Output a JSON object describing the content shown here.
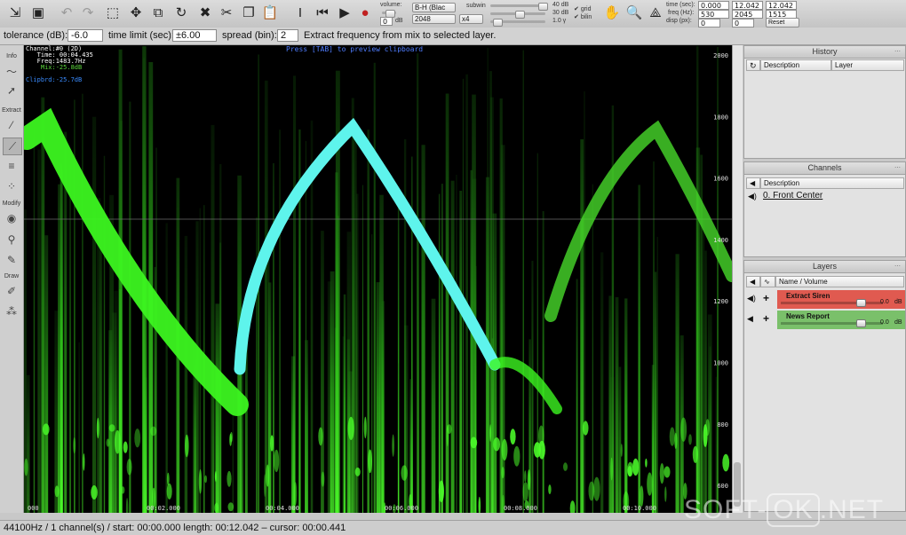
{
  "toolbar": {
    "volume_label": "volume:",
    "volume_value": "0",
    "volume_unit": "dB",
    "colormap": "B-H (Blac",
    "fft_size": "2048",
    "subwin_label": "subwin",
    "multiplier": "x4",
    "db_top": "40 dB",
    "db_mid": "30 dB",
    "db_gamma": "1.0 γ",
    "grid_label": "grid",
    "bilin_label": "bilin",
    "time_label": "time (sec):",
    "time_start": "0.000",
    "time_mid": "12.042",
    "time_end": "12.042",
    "freq_label": "freq (Hz):",
    "freq_start": "530",
    "freq_mid": "2045",
    "freq_end": "1515",
    "disp_label": "disp (px):",
    "disp_start": "0",
    "disp_end": "0",
    "reset_view": "Reset View"
  },
  "options": {
    "tolerance_label": "tolerance (dB):",
    "tolerance_value": "-6.0",
    "time_limit_label": "time limit (sec):",
    "time_limit_value": "±6.00",
    "spread_label": "spread (bin):",
    "spread_value": "2",
    "hint": "Extract frequency from mix to selected layer."
  },
  "left_panel": {
    "info_label": "Info",
    "extract_label": "Extract",
    "modify_label": "Modify",
    "draw_label": "Draw"
  },
  "spectrogram": {
    "preview_hint": "Press [TAB] to preview clipboard",
    "readout_channel": "Channel:#0 (2D)",
    "readout_time": "   Time: 00:04.435",
    "readout_freq": "   Freq:1483.7Hz",
    "readout_mix": "    Mix:-25.8dB",
    "readout_clipbrd": "Clipbrd:-25.7dB",
    "freq_ticks": [
      "2000",
      "1800",
      "1600",
      "1400",
      "1200",
      "1000",
      "800",
      "600"
    ],
    "time_ticks": [
      "000",
      "00:02.000",
      "00:04.000",
      "00:06.000",
      "00:08.000",
      "00:10.000"
    ]
  },
  "history": {
    "title": "History",
    "col_description": "Description",
    "col_layer": "Layer"
  },
  "channels": {
    "title": "Channels",
    "col_description": "Description",
    "item": "0. Front Center"
  },
  "layers": {
    "title": "Layers",
    "col_name": "Name / Volume",
    "items": [
      {
        "name": "Extract Siren",
        "value": "0.0",
        "unit": "dB",
        "color": "#e05a50",
        "volume_fraction": 0.8
      },
      {
        "name": "News Report",
        "value": "0.0",
        "unit": "dB",
        "color": "#7ac06a",
        "volume_fraction": 0.8
      }
    ]
  },
  "status": "44100Hz / 1 channel(s) / start: 00:00.000  length:  00:12.042 – cursor:  00:00.441",
  "watermark": {
    "pre": "SOFT-",
    "boxed": "OK",
    "post": ".NET"
  }
}
